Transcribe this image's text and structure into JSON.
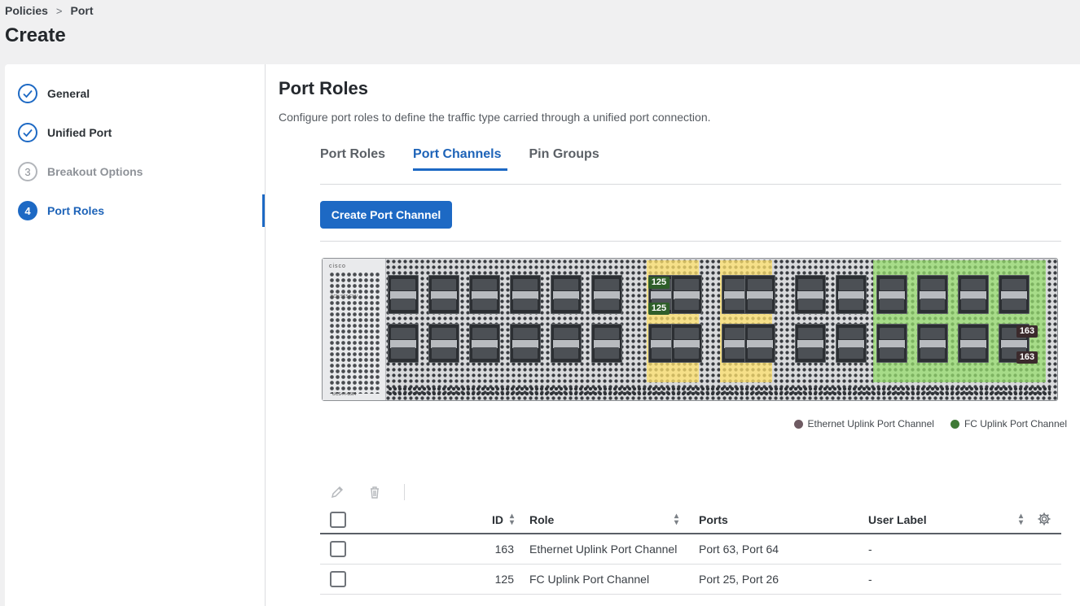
{
  "breadcrumb": {
    "items": [
      "Policies",
      "Port"
    ],
    "separator": ">"
  },
  "page_title": "Create",
  "steps": [
    {
      "index": "1",
      "label": "General",
      "state": "done"
    },
    {
      "index": "2",
      "label": "Unified Port",
      "state": "done"
    },
    {
      "index": "3",
      "label": "Breakout Options",
      "state": "todo"
    },
    {
      "index": "4",
      "label": "Port Roles",
      "state": "active"
    }
  ],
  "main": {
    "title": "Port Roles",
    "description": "Configure port roles to define the traffic type carried through a unified port connection.",
    "tabs": [
      {
        "label": "Port Roles",
        "active": false
      },
      {
        "label": "Port Channels",
        "active": true
      },
      {
        "label": "Pin Groups",
        "active": false
      }
    ],
    "create_button": "Create Port Channel"
  },
  "chassis": {
    "brand": "cisco",
    "model": "UCS-FI-6664",
    "led_labels": "BCN STS ENV",
    "tags": {
      "fc_top": "125",
      "fc_bottom": "125",
      "eth_top": "163",
      "eth_bottom": "163"
    }
  },
  "legend": [
    {
      "label": "Ethernet Uplink Port Channel",
      "color": "#6e5a62"
    },
    {
      "label": "FC Uplink Port Channel",
      "color": "#3f7a35"
    }
  ],
  "table": {
    "columns": [
      "ID",
      "Role",
      "Ports",
      "User Label"
    ],
    "rows": [
      {
        "id": "163",
        "role": "Ethernet Uplink Port Channel",
        "ports": "Port 63, Port 64",
        "user_label": "-"
      },
      {
        "id": "125",
        "role": "FC Uplink Port Channel",
        "ports": "Port 25, Port 26",
        "user_label": "-"
      }
    ]
  },
  "colors": {
    "accent": "#1d69c4",
    "fc_highlight": "#96dc6e",
    "eth_highlight": "#ffe26e"
  }
}
